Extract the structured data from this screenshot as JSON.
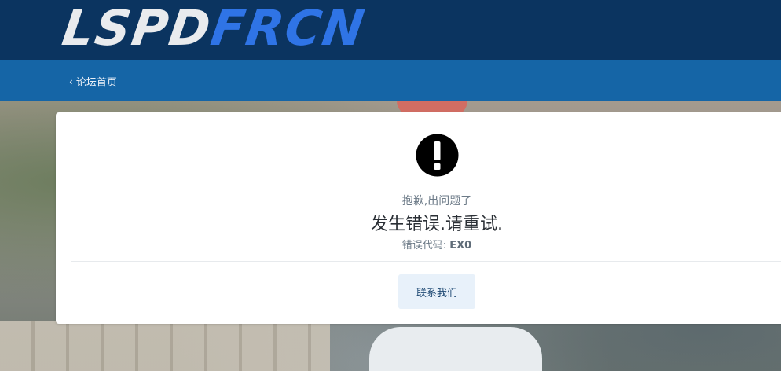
{
  "header": {
    "logo_part1": "LSPD",
    "logo_part2": "FRCN",
    "logo_colors": {
      "part1": "#e9ebee",
      "part2": "#2f74e6"
    },
    "background": "#0b3460"
  },
  "subnav": {
    "back_label": "论坛首页",
    "back_icon": "chevron-left-icon",
    "background": "#1565a6"
  },
  "error_card": {
    "icon": "exclamation-circle-icon",
    "subtitle": "抱歉,出问题了",
    "title": "发生错误.请重试.",
    "code_label": "错误代码:",
    "code_value": "EX0",
    "contact_button": "联系我们"
  }
}
